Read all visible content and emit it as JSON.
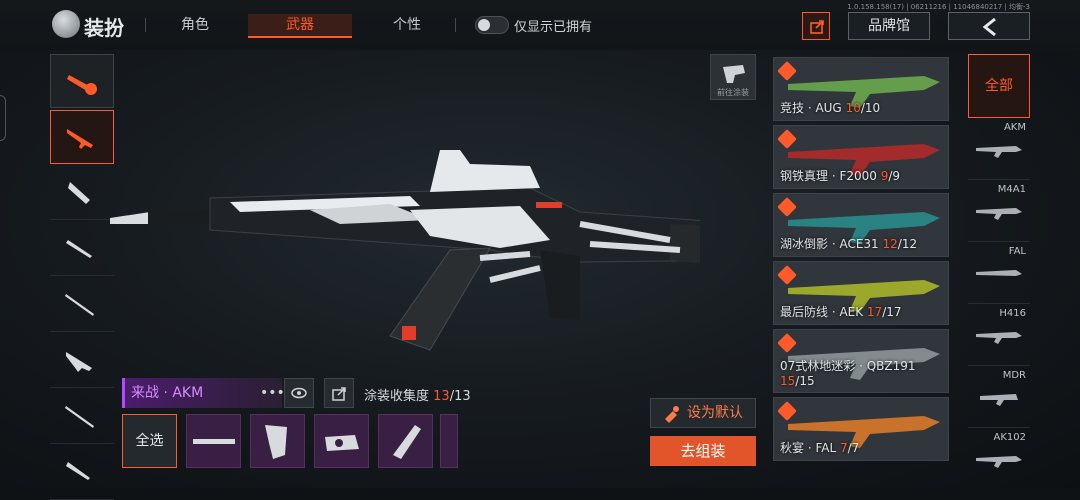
{
  "header": {
    "title": "装扮",
    "tabs": [
      {
        "label": "角色"
      },
      {
        "label": "武器"
      },
      {
        "label": "个性"
      }
    ],
    "toggle_label": "仅显示已拥有",
    "version": "1.0.158.158(17) | 06211216 | 11046840217 | 均衡-3",
    "brand_label": "品牌馆"
  },
  "goto_skin_label": "前往涂装",
  "skin": {
    "name": "来战 · AKM",
    "collection_label": "涂装收集度",
    "collection_current": "13",
    "collection_total": "/13"
  },
  "select_all_label": "全选",
  "set_default_label": "设为默认",
  "assemble_label": "去组装",
  "skin_list": [
    {
      "prefix": "竞技 · AUG ",
      "owned": "10",
      "total": "/10",
      "color": "#6aa84f"
    },
    {
      "prefix": "钢铁真理 · F2000 ",
      "owned": "9",
      "total": "/9",
      "color": "#b02a2a"
    },
    {
      "prefix": "湖冰倒影 · ACE31 ",
      "owned": "12",
      "total": "/12",
      "color": "#2b8b8b"
    },
    {
      "prefix": "最后防线 · AEK ",
      "owned": "17",
      "total": "/17",
      "color": "#a9b52a"
    },
    {
      "prefix": "07式林地迷彩 · QBZ191 ",
      "owned": "15",
      "total": "/15",
      "color": "#8d9598"
    },
    {
      "prefix": "秋宴 · FAL ",
      "owned": "7",
      "total": "/7",
      "color": "#d9792a"
    }
  ],
  "filter": {
    "all_label": "全部",
    "weapons": [
      "AKM",
      "M4A1",
      "FAL",
      "H416",
      "MDR",
      "AK102"
    ]
  }
}
